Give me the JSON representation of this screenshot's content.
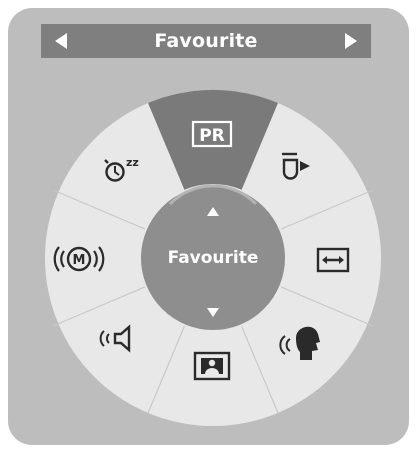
{
  "header": {
    "title": "Favourite",
    "prev_icon": "triangle-left-icon",
    "next_icon": "triangle-right-icon"
  },
  "wheel": {
    "center_label": "Favourite",
    "items": [
      {
        "name": "pr",
        "icon": "pr-icon",
        "label": "PR",
        "selected": true
      },
      {
        "name": "input-source",
        "icon": "input-source-icon"
      },
      {
        "name": "aspect-ratio",
        "icon": "aspect-ratio-icon"
      },
      {
        "name": "voice",
        "icon": "voice-icon"
      },
      {
        "name": "picture",
        "icon": "picture-icon"
      },
      {
        "name": "sound",
        "icon": "speaker-icon"
      },
      {
        "name": "audio-mode",
        "icon": "mono-stereo-icon",
        "label": "M"
      },
      {
        "name": "sleep-timer",
        "icon": "sleep-timer-icon",
        "label": "zz"
      }
    ]
  },
  "colors": {
    "background": "#bdbdbd",
    "header": "#7f7f7f",
    "wheel": "#e8e8e8",
    "selected": "#7a7a7a",
    "center": "#8e8e8e",
    "icon": "#2a2a2a"
  }
}
